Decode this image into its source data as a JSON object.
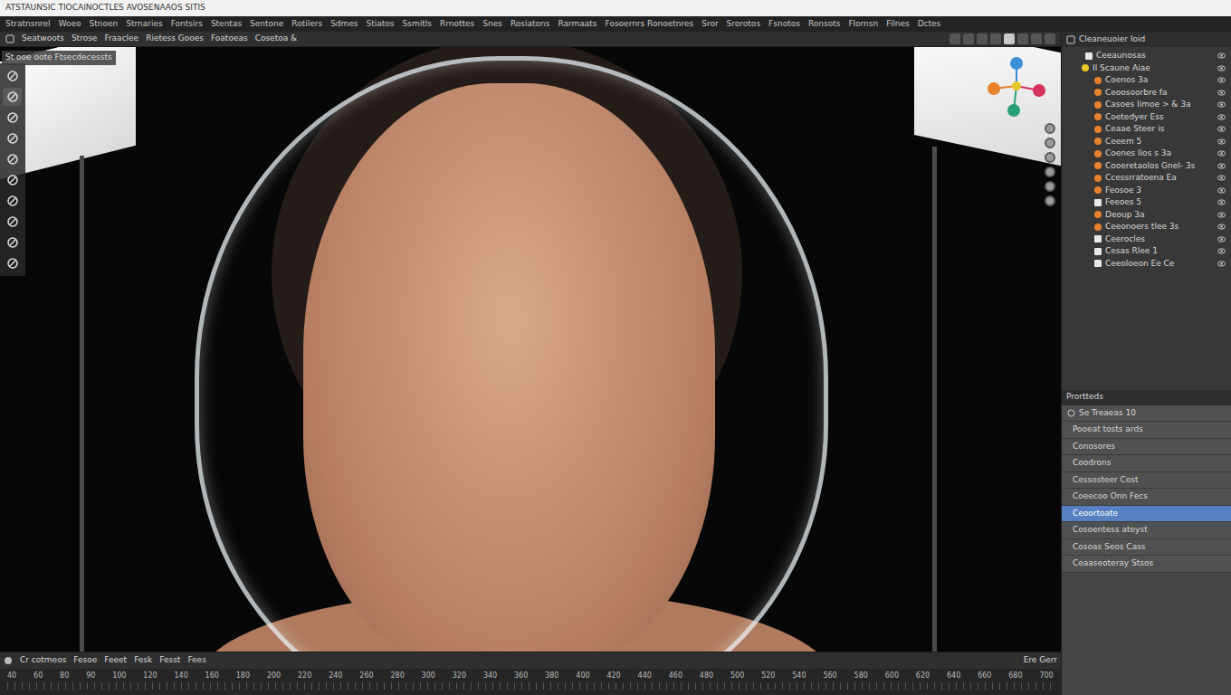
{
  "window": {
    "title": "ATSTAUNSIC TIOCAINOCTLES AVOSENAAOS SITIS"
  },
  "menu": [
    "Stratnsnrel",
    "Woeo",
    "Stnoen",
    "Strnaries",
    "Fontsirs",
    "Stentas",
    "Sentone",
    "Rotilers",
    "Sdmes",
    "Stiatos",
    "Ssmitls",
    "Rrnottes",
    "Snes",
    "Rosiatons",
    "Rarmaats",
    "Fosoernrs Ronoetnres",
    "Sror",
    "Srorotos",
    "Fsnotos",
    "Ronsots",
    "Flornsn",
    "Filnes",
    "Dctes"
  ],
  "toolbar": [
    "Seatwoots",
    "Strose",
    "Fraaclee",
    "Rietess Gooes",
    "Foatoeas",
    "Cosetoa &"
  ],
  "header_buttons": [
    {
      "selected": false
    },
    {
      "selected": false
    },
    {
      "selected": false
    },
    {
      "selected": false
    },
    {
      "selected": true
    },
    {
      "selected": false
    },
    {
      "selected": false
    },
    {
      "selected": false
    }
  ],
  "viewport": {
    "label": "St ooe oote Ftsecdecessts"
  },
  "tools": [
    {
      "selected": false
    },
    {
      "selected": true
    },
    {
      "selected": false
    },
    {
      "selected": false
    },
    {
      "selected": false
    },
    {
      "selected": false
    },
    {
      "selected": false
    },
    {
      "selected": false
    },
    {
      "selected": false
    },
    {
      "selected": false
    }
  ],
  "outliner": {
    "title": "Cleaneuoier Ioid",
    "items": [
      {
        "label": "Ceeaunosas",
        "kind": "collection"
      },
      {
        "label": "Il Scaune Aiae",
        "kind": "scene"
      },
      {
        "label": "Coenos 3a",
        "kind": "object"
      },
      {
        "label": "Ceoosoorbre fa",
        "kind": "object"
      },
      {
        "label": "Casoes Iimoe > & 3a",
        "kind": "object"
      },
      {
        "label": "Coetedyer Ess",
        "kind": "object"
      },
      {
        "label": "Ceaae Steer is",
        "kind": "object"
      },
      {
        "label": "Ceeem 5",
        "kind": "object"
      },
      {
        "label": "Coenes lios s 3a",
        "kind": "object"
      },
      {
        "label": "Cooeretaolos Gnel- 3s",
        "kind": "object"
      },
      {
        "label": "Ccessrratoena Ea",
        "kind": "object"
      },
      {
        "label": "Feosoe 3",
        "kind": "object"
      },
      {
        "label": "Feeoes 5",
        "kind": "mesh"
      },
      {
        "label": "Deoup 3a",
        "kind": "object"
      },
      {
        "label": "Ceeonoers tlee 3s",
        "kind": "object"
      },
      {
        "label": "Ceerocles",
        "kind": "mesh"
      },
      {
        "label": "Cesas Rlee 1",
        "kind": "mesh"
      },
      {
        "label": "Ceeoloeon Ee Ce",
        "kind": "mesh"
      }
    ]
  },
  "properties": {
    "title": "Prortteds",
    "subtitle": "Se Treaeas 10",
    "items": [
      {
        "label": "Pooeat tosts ards",
        "selected": false
      },
      {
        "label": "Conosores",
        "selected": false
      },
      {
        "label": "Coodrons",
        "selected": false
      },
      {
        "label": "Cessosteer Cost",
        "selected": false
      },
      {
        "label": "Coeecoo Onn Fecs",
        "selected": false
      },
      {
        "label": "Ceoortoate",
        "selected": true
      },
      {
        "label": "Cosoentess ateyst",
        "selected": false
      },
      {
        "label": "Cosoas Seos Cass",
        "selected": false
      },
      {
        "label": "Ceaaseoteray Stsos",
        "selected": false
      }
    ]
  },
  "timeline": {
    "menu": [
      "Cr cotmeos",
      "Fesoe",
      "Feeet",
      "Fesk",
      "Fesst",
      "Fees"
    ],
    "right": "Ere Gerr",
    "ruler": [
      "40",
      "60",
      "80",
      "90",
      "100",
      "120",
      "140",
      "160",
      "180",
      "200",
      "220",
      "240",
      "260",
      "280",
      "300",
      "320",
      "340",
      "360",
      "380",
      "400",
      "420",
      "440",
      "460",
      "480",
      "500",
      "520",
      "540",
      "560",
      "580",
      "600",
      "620",
      "640",
      "660",
      "680",
      "700"
    ]
  }
}
